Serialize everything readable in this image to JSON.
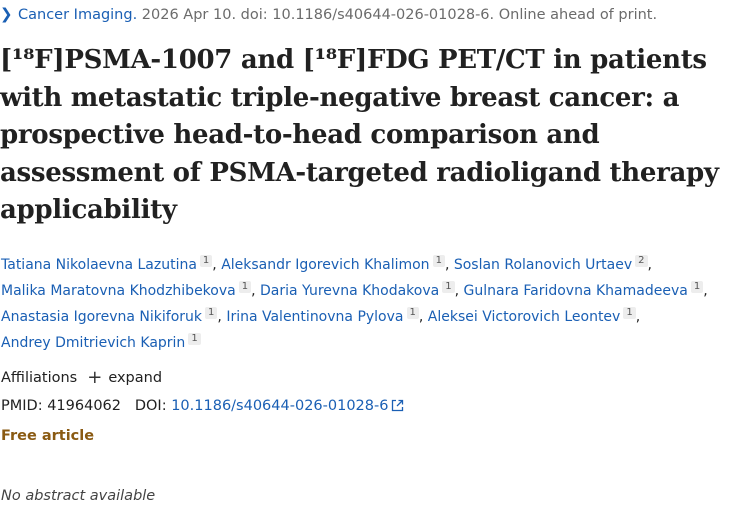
{
  "citation": {
    "journal": "Cancer Imaging.",
    "details": "2026 Apr 10. doi: 10.1186/s40644-026-01028-6. Online ahead of print."
  },
  "title": "[¹⁸F]PSMA-1007 and [¹⁸F]FDG PET/CT in patients with metastatic triple-negative breast cancer: a prospective head-to-head comparison and assessment of PSMA-targeted radioligand therapy applicability",
  "authors": [
    {
      "name": "Tatiana Nikolaevna Lazutina",
      "aff": "1"
    },
    {
      "name": "Aleksandr Igorevich Khalimon",
      "aff": "1"
    },
    {
      "name": "Soslan Rolanovich Urtaev",
      "aff": "2"
    },
    {
      "name": "Malika Maratovna Khodzhibekova",
      "aff": "1"
    },
    {
      "name": "Daria Yurevna Khodakova",
      "aff": "1"
    },
    {
      "name": "Gulnara Faridovna Khamadeeva",
      "aff": "1"
    },
    {
      "name": "Anastasia Igorevna Nikiforuk",
      "aff": "1"
    },
    {
      "name": "Irina Valentinovna Pylova",
      "aff": "1"
    },
    {
      "name": "Aleksei Victorovich Leontev",
      "aff": "1"
    },
    {
      "name": "Andrey Dmitrievich Kaprin",
      "aff": "1"
    }
  ],
  "affiliations": {
    "label": "Affiliations",
    "expand_label": "expand"
  },
  "ids": {
    "pmid_label": "PMID:",
    "pmid": "41964062",
    "doi_label": "DOI:",
    "doi": "10.1186/s40644-026-01028-6"
  },
  "free_article": "Free article",
  "no_abstract": "No abstract available",
  "colors": {
    "link": "#1a5fb4",
    "free_article": "#8a5a12"
  },
  "icons": {
    "citation": "chevron-right-icon",
    "expand": "plus-icon",
    "doi": "external-link-icon"
  }
}
